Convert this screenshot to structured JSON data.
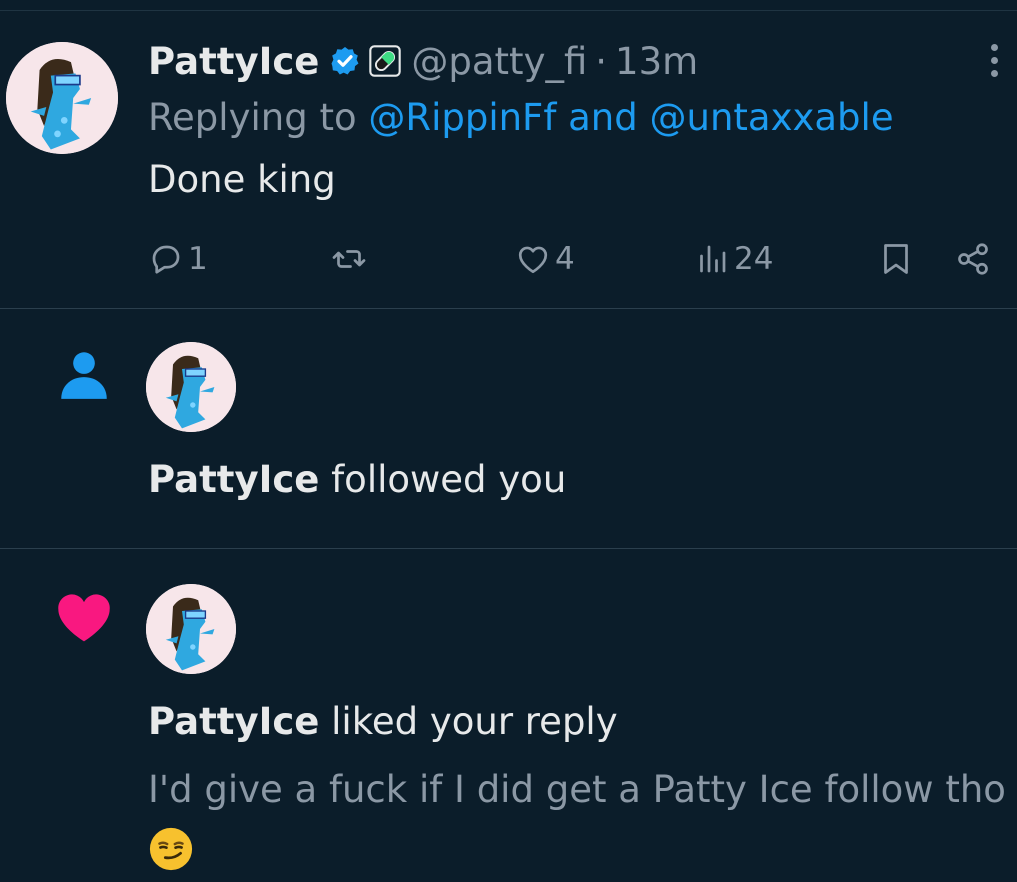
{
  "tweet": {
    "display_name": "PattyIce",
    "verified_icon": "verified-badge-icon",
    "affiliate_icon": "pill-icon",
    "handle": "@patty_fi",
    "separator": "·",
    "time": "13m",
    "replying_prefix": "Replying to ",
    "replying_link_1": "@RippinFf",
    "replying_joiner": " and ",
    "replying_link_2": "@untaxxable",
    "text": "Done king",
    "actions": {
      "reply_count": "1",
      "repost_count": "",
      "like_count": "4",
      "views_count": "24"
    }
  },
  "notifications": [
    {
      "type_icon": "person-icon",
      "name": "PattyIce",
      "action": " followed you"
    },
    {
      "type_icon": "heart-icon",
      "name": "PattyIce",
      "action": " liked your reply",
      "quoted_text": "I'd give a fuck if I did get a Patty Ice follow tho",
      "emoji": "smirking-face-emoji"
    }
  ],
  "colors": {
    "background": "#0b1d2a",
    "accent": "#1d9bf0",
    "muted": "#8b98a5",
    "like": "#f91880"
  }
}
